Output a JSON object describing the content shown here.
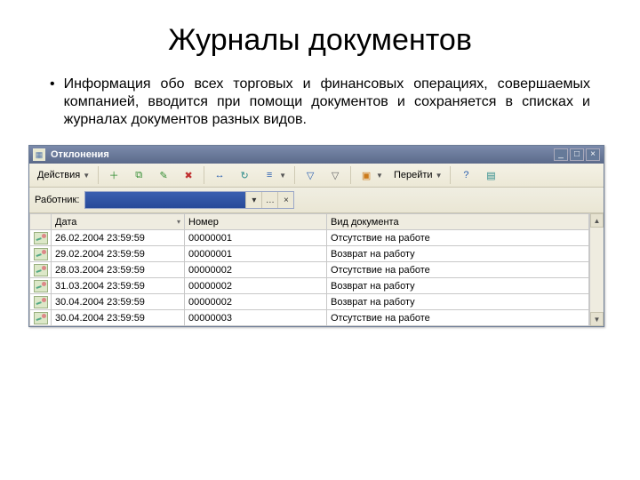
{
  "slide": {
    "title": "Журналы документов",
    "bullet": "Информация обо всех торговых и финансовых операциях, совершаемых компанией, вводится при помощи документов и сохраняется в списках и журналах документов разных видов."
  },
  "window": {
    "title": "Отклонения",
    "buttons": {
      "min": "_",
      "max": "□",
      "close": "×"
    }
  },
  "toolbar": {
    "actions_label": "Действия",
    "goto_label": "Перейти",
    "icons": {
      "add": "＋",
      "copy": "⧉",
      "edit": "✎",
      "delete": "✖",
      "range": "↔",
      "refresh": "↻",
      "filter": "≡",
      "funnel_set": "▽",
      "funnel_clear": "▽",
      "export": "▣",
      "help": "?",
      "report": "▤"
    }
  },
  "filter": {
    "label": "Работник:",
    "value": "",
    "pick": "…",
    "clear": "×",
    "drop": "▾"
  },
  "grid": {
    "headers": {
      "icon": "",
      "date": "Дата",
      "number": "Номер",
      "doctype": "Вид документа"
    },
    "rows": [
      {
        "date": "26.02.2004 23:59:59",
        "number": "00000001",
        "doctype": "Отсутствие на работе"
      },
      {
        "date": "29.02.2004 23:59:59",
        "number": "00000001",
        "doctype": "Возврат на работу"
      },
      {
        "date": "28.03.2004 23:59:59",
        "number": "00000002",
        "doctype": "Отсутствие на работе"
      },
      {
        "date": "31.03.2004 23:59:59",
        "number": "00000002",
        "doctype": "Возврат на работу"
      },
      {
        "date": "30.04.2004 23:59:59",
        "number": "00000002",
        "doctype": "Возврат на работу"
      },
      {
        "date": "30.04.2004 23:59:59",
        "number": "00000003",
        "doctype": "Отсутствие на работе"
      }
    ]
  }
}
